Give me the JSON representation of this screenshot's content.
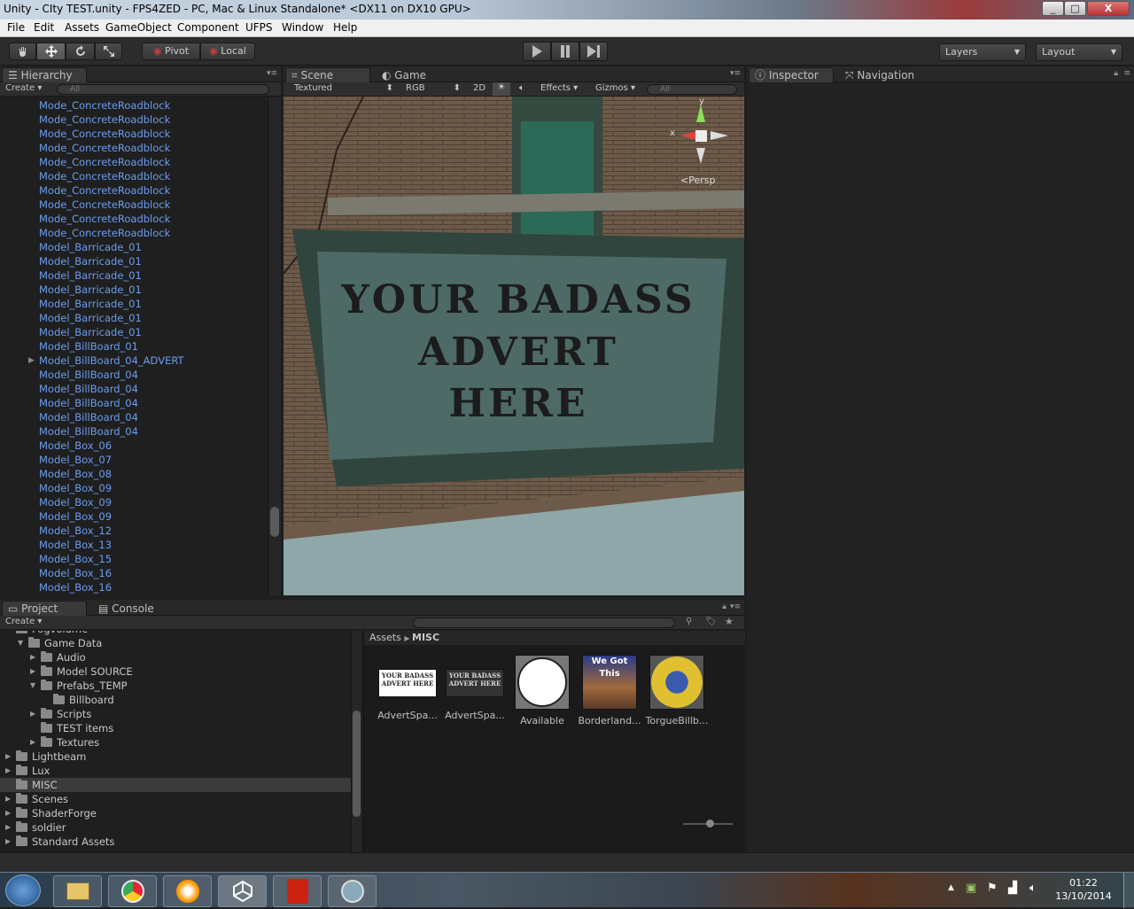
{
  "window": {
    "title": "Unity - CIty TEST.unity - FPS4ZED - PC, Mac & Linux Standalone* <DX11 on DX10 GPU>",
    "minimize": "_",
    "maximize": "□",
    "close": "X"
  },
  "menu": [
    "File",
    "Edit",
    "Assets",
    "GameObject",
    "Component",
    "UFPS",
    "Window",
    "Help"
  ],
  "toolbar": {
    "pivot": "Pivot",
    "local": "Local",
    "layers": "Layers",
    "layout": "Layout"
  },
  "hierarchy": {
    "tab": "Hierarchy",
    "create": "Create",
    "search_placeholder": "All",
    "items": [
      "Mode_ConcreteRoadblock",
      "Mode_ConcreteRoadblock",
      "Mode_ConcreteRoadblock",
      "Mode_ConcreteRoadblock",
      "Mode_ConcreteRoadblock",
      "Mode_ConcreteRoadblock",
      "Mode_ConcreteRoadblock",
      "Mode_ConcreteRoadblock",
      "Mode_ConcreteRoadblock",
      "Mode_ConcreteRoadblock",
      "Model_Barricade_01",
      "Model_Barricade_01",
      "Model_Barricade_01",
      "Model_Barricade_01",
      "Model_Barricade_01",
      "Model_Barricade_01",
      "Model_Barricade_01",
      "Model_BillBoard_01",
      "Model_BillBoard_04_ADVERT",
      "Model_BillBoard_04",
      "Model_BillBoard_04",
      "Model_BillBoard_04",
      "Model_BillBoard_04",
      "Model_BillBoard_04",
      "Model_Box_06",
      "Model_Box_07",
      "Model_Box_08",
      "Model_Box_09",
      "Model_Box_09",
      "Model_Box_09",
      "Model_Box_12",
      "Model_Box_13",
      "Model_Box_15",
      "Model_Box_16",
      "Model_Box_16"
    ]
  },
  "scene": {
    "tab_scene": "Scene",
    "tab_game": "Game",
    "mode": "Textured",
    "color": "RGB",
    "btn_2d": "2D",
    "effects": "Effects",
    "gizmos": "Gizmos",
    "search_placeholder": "All",
    "persp": "Persp",
    "axis_x": "x",
    "axis_y": "y",
    "billboard_text": [
      "YOUR BADASS",
      "ADVERT",
      "HERE"
    ]
  },
  "inspector": {
    "tab": "Inspector",
    "nav_tab": "Navigation"
  },
  "project": {
    "tab": "Project",
    "console_tab": "Console",
    "create": "Create",
    "breadcrumb_root": "Assets",
    "breadcrumb_leaf": "MISC",
    "tree": [
      {
        "label": "Fogvolume",
        "indent": 0,
        "arrow": ""
      },
      {
        "label": "Game Data",
        "indent": 1,
        "arrow": "▼"
      },
      {
        "label": "Audio",
        "indent": 2,
        "arrow": "▶"
      },
      {
        "label": "Model SOURCE",
        "indent": 2,
        "arrow": "▶"
      },
      {
        "label": "Prefabs_TEMP",
        "indent": 2,
        "arrow": "▼"
      },
      {
        "label": "Billboard",
        "indent": 3,
        "arrow": ""
      },
      {
        "label": "Scripts",
        "indent": 2,
        "arrow": "▶"
      },
      {
        "label": "TEST items",
        "indent": 2,
        "arrow": ""
      },
      {
        "label": "Textures",
        "indent": 2,
        "arrow": "▶"
      },
      {
        "label": "Lightbeam",
        "indent": 0,
        "arrow": "▶"
      },
      {
        "label": "Lux",
        "indent": 0,
        "arrow": "▶"
      },
      {
        "label": "MISC",
        "indent": 0,
        "arrow": ""
      },
      {
        "label": "Scenes",
        "indent": 0,
        "arrow": "▶"
      },
      {
        "label": "ShaderForge",
        "indent": 0,
        "arrow": "▶"
      },
      {
        "label": "soldier",
        "indent": 0,
        "arrow": "▶"
      },
      {
        "label": "Standard Assets",
        "indent": 0,
        "arrow": "▶"
      }
    ],
    "assets": [
      {
        "caption": "AdvertSpa...",
        "thumb_text": "YOUR BADASS ADVERT HERE"
      },
      {
        "caption": "AdvertSpa...",
        "thumb_text": "YOUR BADASS ADVERT HERE"
      },
      {
        "caption": "Available",
        "thumb_text": ""
      },
      {
        "caption": "Borderland...",
        "thumb_text": "We Got This"
      },
      {
        "caption": "TorgueBillb...",
        "thumb_text": ""
      }
    ]
  },
  "taskbar": {
    "time": "01:22",
    "date": "13/10/2014"
  },
  "colors": {
    "hierarchy_text": "#6a9df0",
    "panel_bg": "#1f1f1f",
    "selected_row": "#3b3b3b"
  }
}
